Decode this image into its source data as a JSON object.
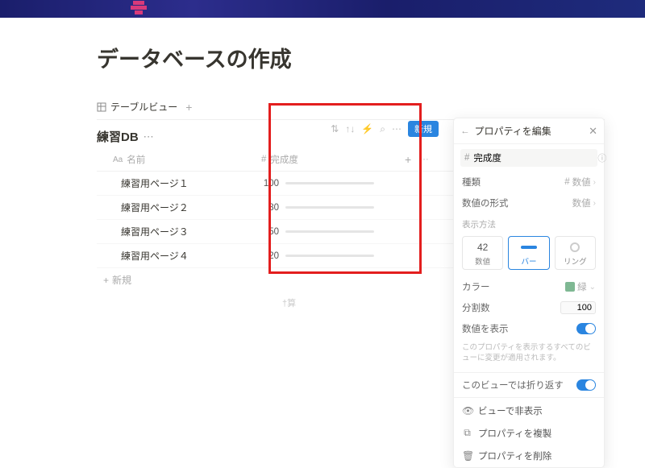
{
  "page": {
    "title": "データベースの作成"
  },
  "db": {
    "view_tab": "テーブルビュー",
    "title": "練習DB",
    "col_name": "名前",
    "col_progress": "完成度",
    "rows": [
      {
        "name": "練習用ページ１",
        "value": 100,
        "pct": 100
      },
      {
        "name": "練習用ページ２",
        "value": 80,
        "pct": 80
      },
      {
        "name": "練習用ページ３",
        "value": 50,
        "pct": 50
      },
      {
        "name": "練習用ページ４",
        "value": 20,
        "pct": 20
      }
    ],
    "new_row": "新規",
    "footer": "†算"
  },
  "toolbar": {
    "new_btn": "新規"
  },
  "panel": {
    "title": "プロパティを編集",
    "name_value": "完成度",
    "type_label": "種類",
    "type_value": "数値",
    "format_label": "数値の形式",
    "format_value": "数値",
    "display_label": "表示方法",
    "opts": {
      "number": "数値",
      "number_sample": "42",
      "bar": "バー",
      "ring": "リング"
    },
    "color_label": "カラー",
    "color_value": "緑",
    "divisor_label": "分割数",
    "divisor_value": "100",
    "show_number_label": "数値を表示",
    "hint": "このプロパティを表示するすべてのビューに変更が適用されます。",
    "wrap_label": "このビューでは折り返す",
    "hide_label": "ビューで非表示",
    "dup_label": "プロパティを複製",
    "del_label": "プロパティを削除"
  }
}
